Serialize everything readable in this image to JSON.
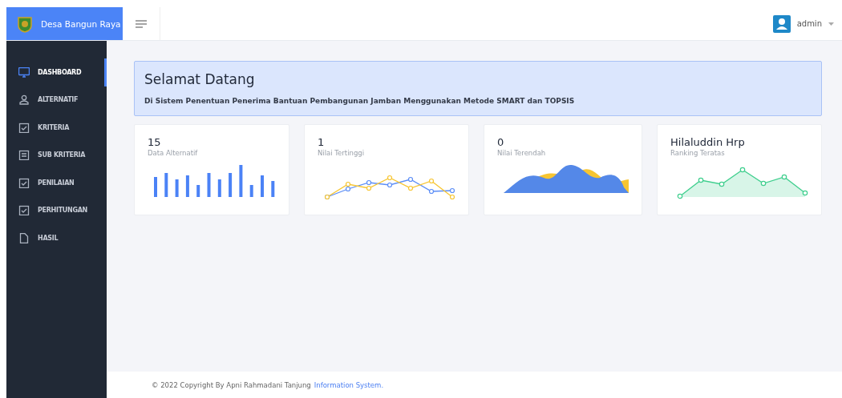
{
  "brand": {
    "name": "Desa Bangun Raya"
  },
  "user": {
    "name": "admin"
  },
  "sidebar": {
    "items": [
      {
        "label": "DASHBOARD",
        "kind": "monitor",
        "selected": true
      },
      {
        "label": "ALTERNATIF",
        "kind": "user",
        "selected": false
      },
      {
        "label": "KRITERIA",
        "kind": "check",
        "selected": false
      },
      {
        "label": "SUB KRITERIA",
        "kind": "list",
        "selected": false
      },
      {
        "label": "PENILAIAN",
        "kind": "check",
        "selected": false
      },
      {
        "label": "PERHITUNGAN",
        "kind": "check",
        "selected": false
      },
      {
        "label": "HASIL",
        "kind": "file",
        "selected": false
      }
    ]
  },
  "welcome": {
    "title": "Selamat Datang",
    "text": "Di Sistem Penentuan Penerima Bantuan Pembangunan Jamban Menggunakan Metode SMART dan TOPSIS"
  },
  "cards": [
    {
      "value": "15",
      "label": "Data Alternatif",
      "kind": "bars"
    },
    {
      "value": "1",
      "label": "Nilai Tertinggi",
      "kind": "lines"
    },
    {
      "value": "0",
      "label": "Nilai Terendah",
      "kind": "waves"
    },
    {
      "value": "Hilaluddin Hrp",
      "label": "Ranking Teratas",
      "kind": "area"
    }
  ],
  "footer": {
    "text": "© 2022 Copyright By Apni Rahmadani Tanjung",
    "link": "Information System."
  }
}
